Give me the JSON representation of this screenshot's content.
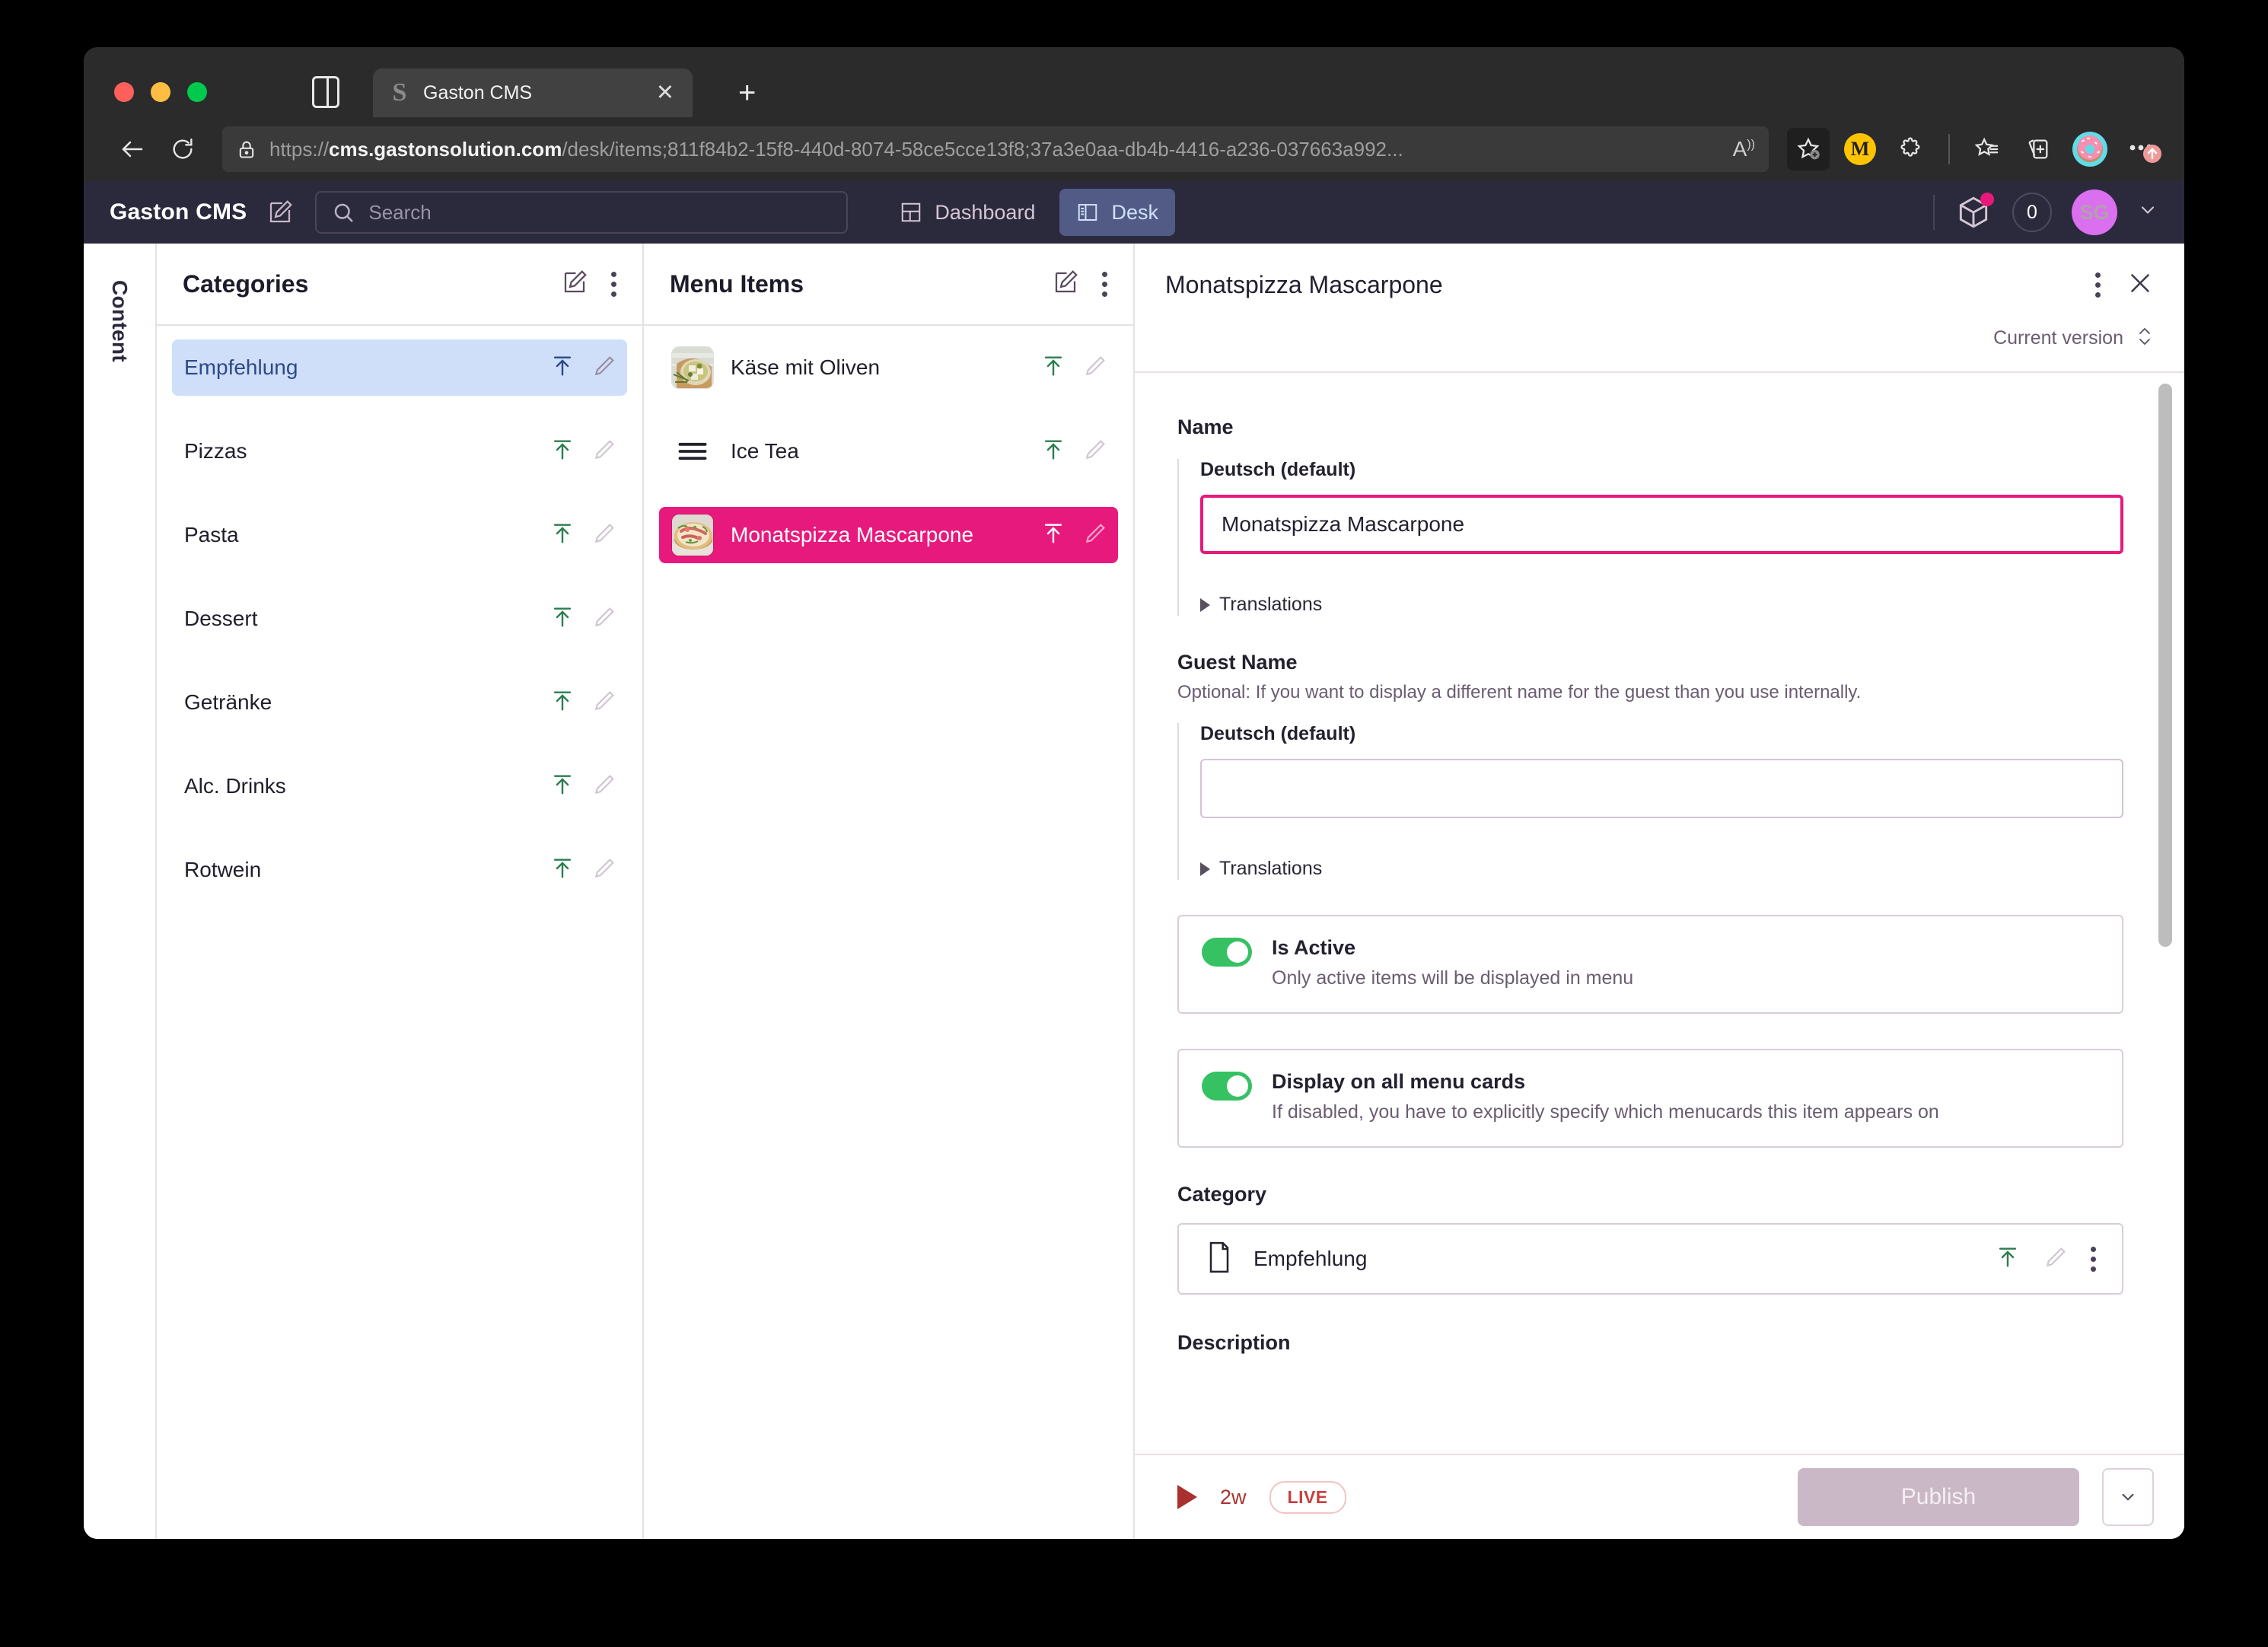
{
  "browser": {
    "tab": {
      "title": "Gaston CMS",
      "favicon_glyph": "S"
    },
    "url_prefix": "https://",
    "url_domain": "cms.gastonsolution.com",
    "url_path": "/desk/items;811f84b2-15f8-440d-8074-58ce5cce13f8;37a3e0aa-db4b-4416-a236-037663a992...",
    "icons": [
      "back-icon",
      "reload-icon",
      "lock-icon",
      "read-aloud-icon",
      "add-favorite-icon",
      "extension-m-icon",
      "extensions-icon",
      "favorites-icon",
      "collections-icon",
      "profile-donut-icon",
      "settings-more-icon"
    ]
  },
  "appbar": {
    "brand": "Gaston CMS",
    "search_placeholder": "Search",
    "nav": [
      {
        "label": "Dashboard",
        "selected": false
      },
      {
        "label": "Desk",
        "selected": true
      }
    ],
    "count": "0",
    "avatar_initials": "SG"
  },
  "rail": {
    "label": "Content"
  },
  "categories_pane": {
    "title": "Categories",
    "items": [
      {
        "label": "Empfehlung",
        "selected": true
      },
      {
        "label": "Pizzas",
        "selected": false
      },
      {
        "label": "Pasta",
        "selected": false
      },
      {
        "label": "Dessert",
        "selected": false
      },
      {
        "label": "Getränke",
        "selected": false
      },
      {
        "label": "Alc. Drinks",
        "selected": false
      },
      {
        "label": "Rotwein",
        "selected": false
      }
    ]
  },
  "items_pane": {
    "title": "Menu Items",
    "items": [
      {
        "label": "Käse mit Oliven",
        "selected": false,
        "media": "thumbnail-cheese-olives"
      },
      {
        "label": "Ice Tea",
        "selected": false,
        "media": "list-icon"
      },
      {
        "label": "Monatspizza Mascarpone",
        "selected": true,
        "media": "thumbnail-pizza"
      }
    ]
  },
  "detail": {
    "title": "Monatspizza Mascarpone",
    "version_label": "Current version",
    "name": {
      "label": "Name",
      "locale_label": "Deutsch (default)",
      "value": "Monatspizza Mascarpone",
      "translations_label": "Translations"
    },
    "guest_name": {
      "label": "Guest Name",
      "help": "Optional: If you want to display a different name for the guest than you use internally.",
      "locale_label": "Deutsch (default)",
      "value": "",
      "translations_label": "Translations"
    },
    "toggles": [
      {
        "title": "Is Active",
        "sub": "Only active items will be displayed in menu",
        "on": true
      },
      {
        "title": "Display on all menu cards",
        "sub": "If disabled, you have to explicitly specify which menucards this item appears on",
        "on": true
      }
    ],
    "category": {
      "label": "Category",
      "value": "Empfehlung"
    },
    "description_label": "Description"
  },
  "footer": {
    "age": "2w",
    "status_badge": "LIVE",
    "publish_label": "Publish"
  },
  "colors": {
    "accent_pink": "#e8197d",
    "appbar_bg": "#2b2a3d",
    "selected_blue": "#cfdffa",
    "toggle_green": "#36c163",
    "live_red": "#c7403e"
  }
}
